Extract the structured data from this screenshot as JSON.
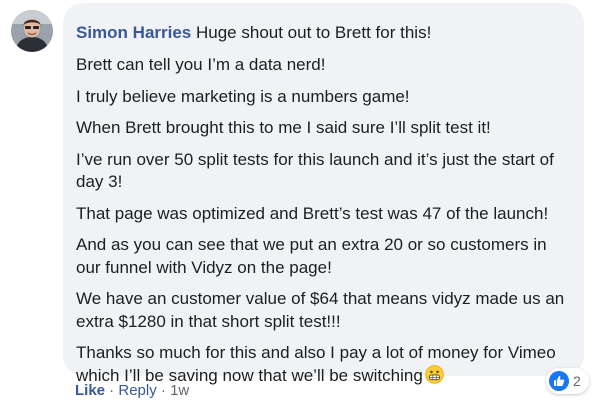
{
  "comment": {
    "author": "Simon Harries",
    "first_line": "Huge shout out to Brett for this!",
    "paragraphs": [
      "Brett can tell you I’m a data nerd!",
      "I truly believe marketing is a numbers game!",
      "When Brett brought this to me I said sure I’ll split test it!",
      "I’ve run over 50 split tests for this launch and it’s just the start of day 3!",
      "That page was optimized and Brett’s test was 47 of the launch!",
      "And as you can see that we put an extra 20 or so customers in our funnel with Vidyz on the page!",
      "We have an customer value of $64 that means vidyz made us an extra $1280 in that short split test!!!",
      "Thanks so much for this and also I pay a lot of money for Vimeo which I’ll be saving now that we’ll be switching"
    ],
    "emoji": "grinning-face-emoji"
  },
  "actions": {
    "like_label": "Like",
    "separator": " · ",
    "reply_label": "Reply",
    "timestamp": "1w"
  },
  "reactions": {
    "icon": "thumbs-up-icon",
    "count": "2",
    "color": "#1877f2"
  },
  "colors": {
    "bubble": "#f0f2f5",
    "author": "#385898",
    "text": "#1c1e21",
    "meta": "#606770"
  }
}
